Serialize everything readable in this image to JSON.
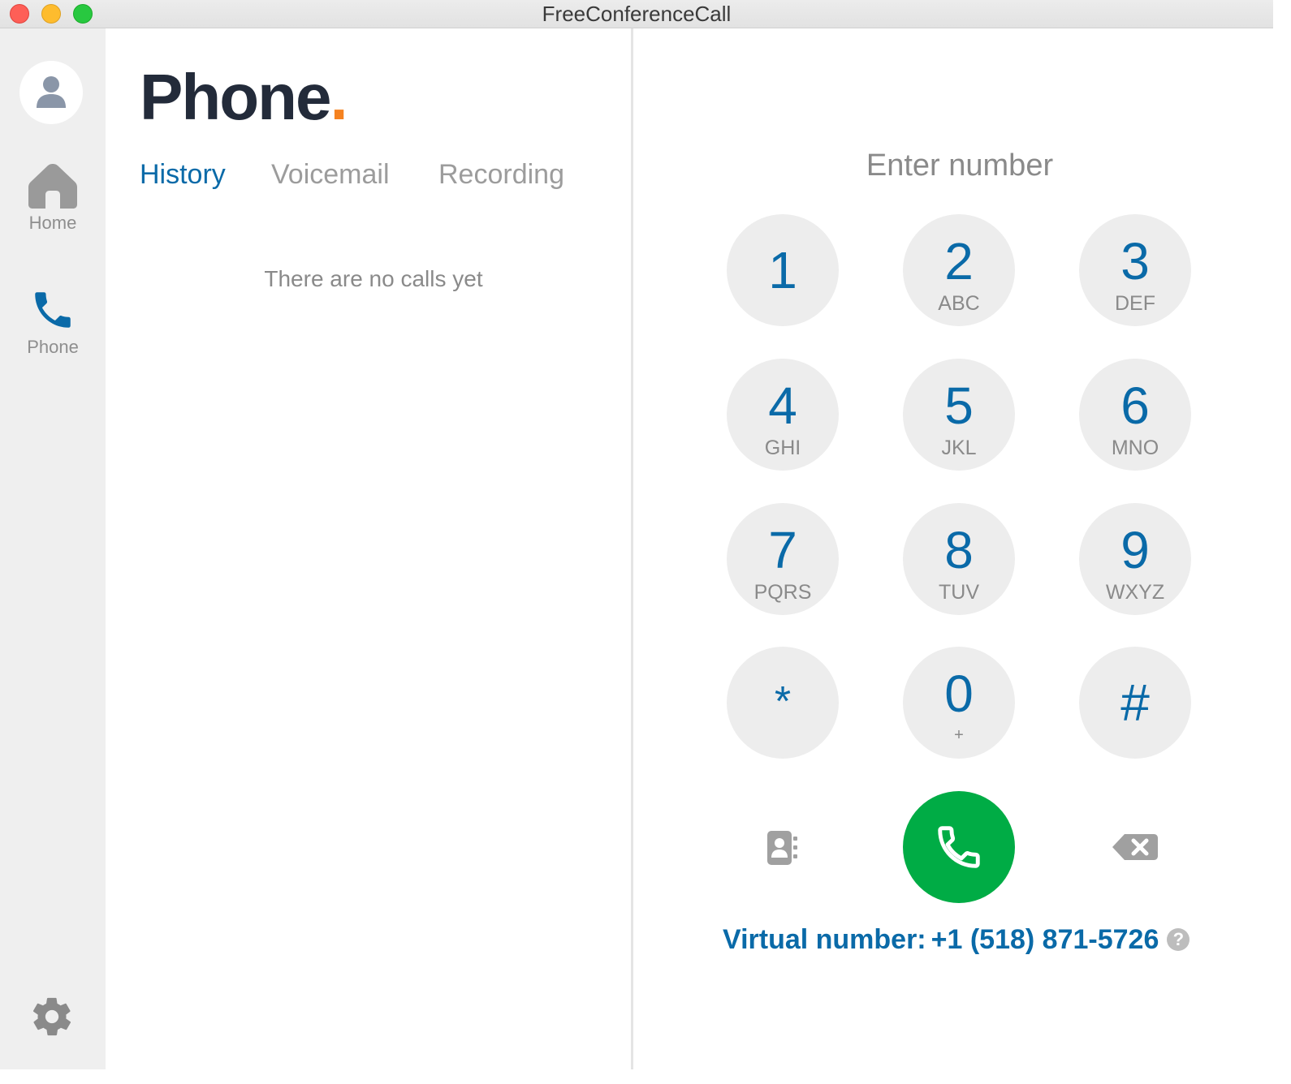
{
  "window": {
    "title": "FreeConferenceCall"
  },
  "sidebar": {
    "items": [
      {
        "label": "Home",
        "icon": "home-icon"
      },
      {
        "label": "Phone",
        "icon": "phone-icon"
      }
    ]
  },
  "main": {
    "title": "Phone",
    "title_dot": ".",
    "tabs": [
      {
        "label": "History",
        "active": true
      },
      {
        "label": "Voicemail",
        "active": false
      },
      {
        "label": "Recording",
        "active": false
      }
    ],
    "empty_message": "There are no calls yet"
  },
  "dialer": {
    "placeholder": "Enter number",
    "keys": [
      {
        "digit": "1",
        "letters": ""
      },
      {
        "digit": "2",
        "letters": "ABC"
      },
      {
        "digit": "3",
        "letters": "DEF"
      },
      {
        "digit": "4",
        "letters": "GHI"
      },
      {
        "digit": "5",
        "letters": "JKL"
      },
      {
        "digit": "6",
        "letters": "MNO"
      },
      {
        "digit": "7",
        "letters": "PQRS"
      },
      {
        "digit": "8",
        "letters": "TUV"
      },
      {
        "digit": "9",
        "letters": "WXYZ"
      },
      {
        "digit": "*",
        "letters": ""
      },
      {
        "digit": "0",
        "letters": "+"
      },
      {
        "digit": "#",
        "letters": ""
      }
    ],
    "virtual_label": "Virtual number:",
    "virtual_number": "+1 (518) 871-5726",
    "help_glyph": "?"
  },
  "colors": {
    "accent": "#0a6aa8",
    "brand_dot": "#f58220",
    "call_green": "#00ac45",
    "sidebar_bg": "#efefef"
  }
}
